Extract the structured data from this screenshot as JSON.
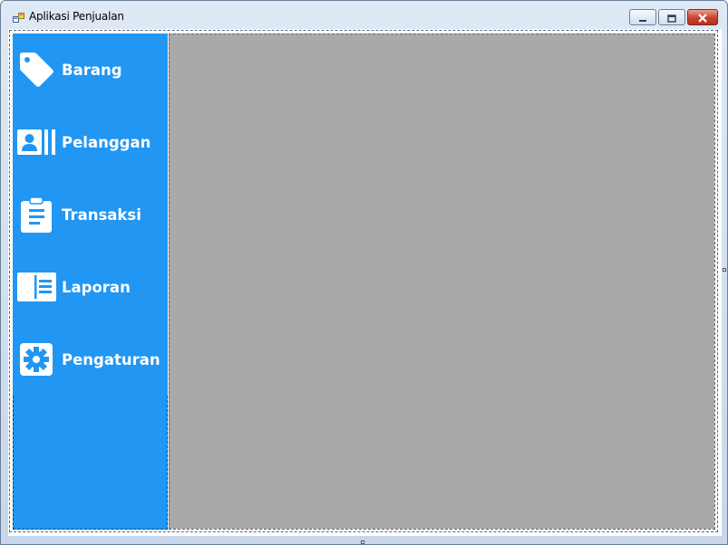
{
  "window": {
    "title": "Aplikasi Penjualan",
    "accent": "#2196f3",
    "content_background": "#a9a9a9"
  },
  "caption_buttons": {
    "minimize_icon": "minimize-icon",
    "maximize_icon": "maximize-icon",
    "close_icon": "close-icon"
  },
  "sidebar": {
    "items": [
      {
        "label": "Barang",
        "icon": "tag-icon"
      },
      {
        "label": "Pelanggan",
        "icon": "contact-card-icon"
      },
      {
        "label": "Transaksi",
        "icon": "clipboard-icon"
      },
      {
        "label": "Laporan",
        "icon": "report-icon"
      },
      {
        "label": "Pengaturan",
        "icon": "gear-icon"
      }
    ]
  }
}
